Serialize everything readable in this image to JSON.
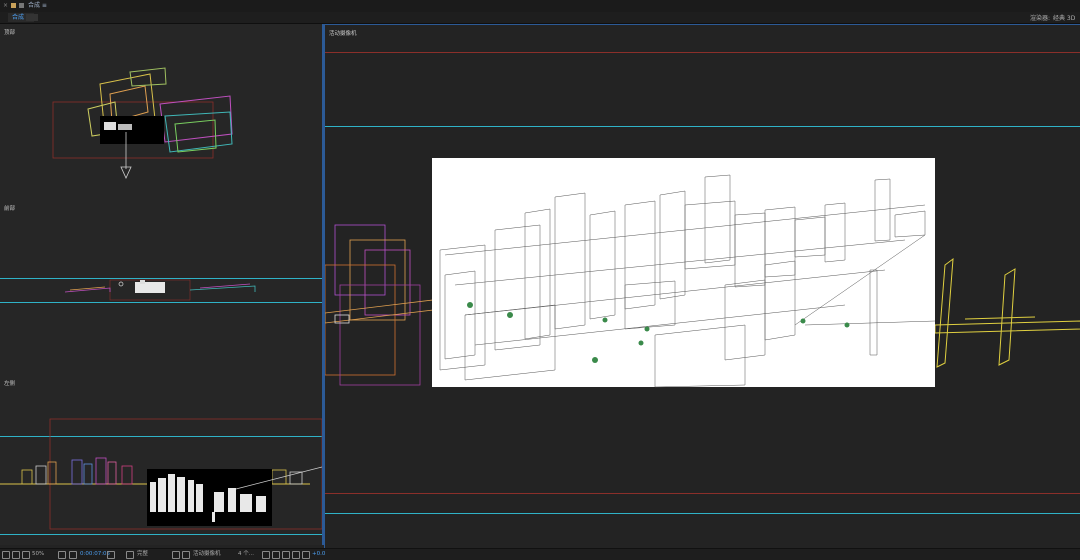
{
  "titlebar": {
    "title": "合成 ≡"
  },
  "tabs": [
    {
      "label": "合成 1",
      "active": true
    }
  ],
  "header_buttons": {
    "left": "渲染器:",
    "right": "经典 3D"
  },
  "views": {
    "top": {
      "label": "顶部"
    },
    "front": {
      "label": "前部"
    },
    "left": {
      "label": "左侧"
    },
    "camera": {
      "label": "活动摄像机"
    }
  },
  "statusbar": {
    "zoom": "50%",
    "timecode": "0:00:07:05",
    "quality": "完整",
    "camera": "活动摄像机",
    "views": "4 个...",
    "exposure": "+0.0"
  },
  "colors": {
    "accent": "#2c5a96",
    "guide_cyan": "#2fb2c7",
    "guide_red": "#8b2f2a"
  }
}
